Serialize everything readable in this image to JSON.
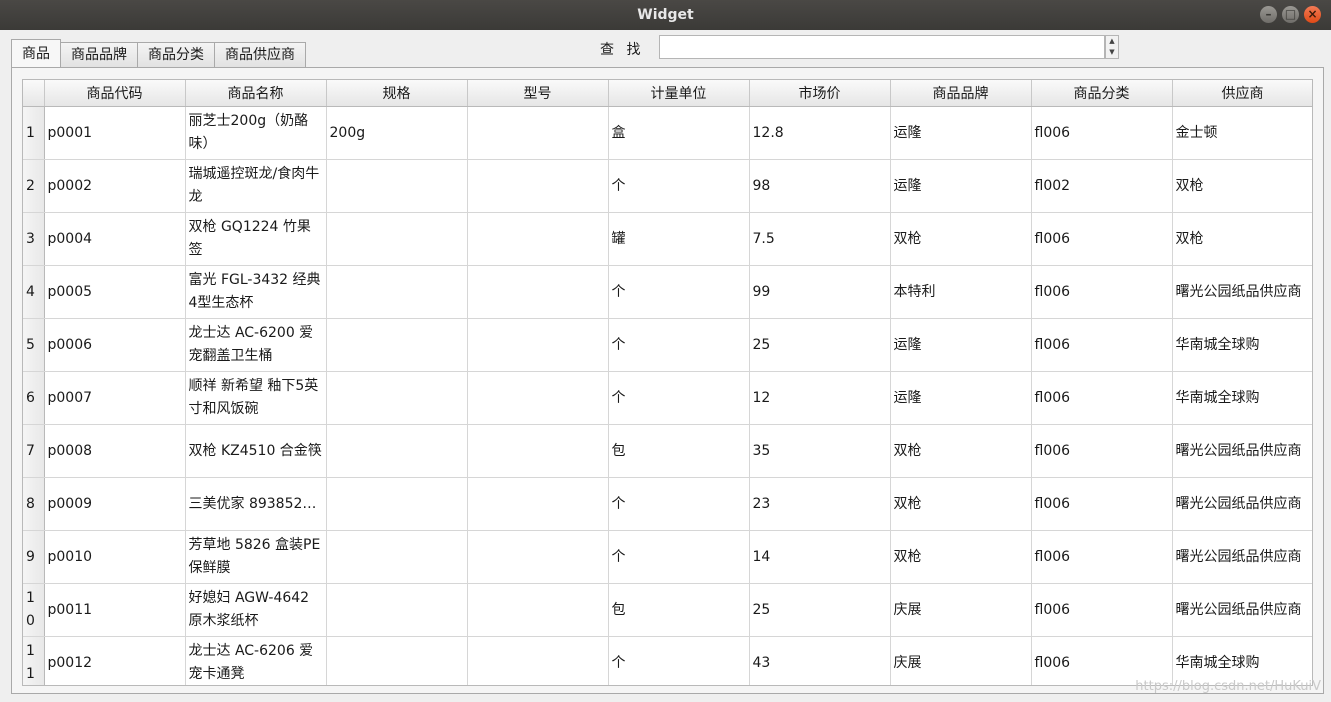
{
  "window": {
    "title": "Widget",
    "minimize": "–",
    "maximize": "□",
    "close": "×"
  },
  "tabs": [
    {
      "label": "商品"
    },
    {
      "label": "商品品牌"
    },
    {
      "label": "商品分类"
    },
    {
      "label": "商品供应商"
    }
  ],
  "search": {
    "label": "查 找",
    "value": ""
  },
  "table": {
    "headers": [
      "商品代码",
      "商品名称",
      "规格",
      "型号",
      "计量单位",
      "市场价",
      "商品品牌",
      "商品分类",
      "供应商"
    ],
    "rows": [
      {
        "n": "1",
        "code": "p0001",
        "name": "丽芝士200g（奶酪味）",
        "spec": "200g",
        "model": "",
        "unit": "盒",
        "price": "12.8",
        "brand": "运隆",
        "cat": "fl006",
        "supplier": "金士顿"
      },
      {
        "n": "2",
        "code": "p0002",
        "name": "瑞城遥控斑龙/食肉牛龙",
        "spec": "",
        "model": "",
        "unit": "个",
        "price": "98",
        "brand": "运隆",
        "cat": "fl002",
        "supplier": "双枪"
      },
      {
        "n": "3",
        "code": "p0004",
        "name": "双枪 GQ1224 竹果签",
        "spec": "",
        "model": "",
        "unit": "罐",
        "price": "7.5",
        "brand": "双枪",
        "cat": "fl006",
        "supplier": "双枪"
      },
      {
        "n": "4",
        "code": "p0005",
        "name": "富光 FGL-3432 经典4型生态杯",
        "spec": "",
        "model": "",
        "unit": "个",
        "price": "99",
        "brand": "本特利",
        "cat": "fl006",
        "supplier": "曙光公园纸品供应商"
      },
      {
        "n": "5",
        "code": "p0006",
        "name": "龙士达 AC-6200 爱宠翻盖卫生桶",
        "spec": "",
        "model": "",
        "unit": "个",
        "price": "25",
        "brand": "运隆",
        "cat": "fl006",
        "supplier": "华南城全球购"
      },
      {
        "n": "6",
        "code": "p0007",
        "name": "顺祥 新希望 釉下5英寸和风饭碗",
        "spec": "",
        "model": "",
        "unit": "个",
        "price": "12",
        "brand": "运隆",
        "cat": "fl006",
        "supplier": "华南城全球购"
      },
      {
        "n": "7",
        "code": "p0008",
        "name": "双枪 KZ4510 合金筷",
        "spec": "",
        "model": "",
        "unit": "包",
        "price": "35",
        "brand": "双枪",
        "cat": "fl006",
        "supplier": "曙光公园纸品供应商"
      },
      {
        "n": "8",
        "code": "p0009",
        "name": "三美优家 893852…",
        "spec": "",
        "model": "",
        "unit": "个",
        "price": "23",
        "brand": "双枪",
        "cat": "fl006",
        "supplier": "曙光公园纸品供应商"
      },
      {
        "n": "9",
        "code": "p0010",
        "name": "芳草地 5826 盒装PE保鲜膜",
        "spec": "",
        "model": "",
        "unit": "个",
        "price": "14",
        "brand": "双枪",
        "cat": "fl006",
        "supplier": "曙光公园纸品供应商"
      },
      {
        "n": "10",
        "code": "p0011",
        "name": "好媳妇 AGW-4642 原木浆纸杯",
        "spec": "",
        "model": "",
        "unit": "包",
        "price": "25",
        "brand": "庆展",
        "cat": "fl006",
        "supplier": "曙光公园纸品供应商"
      },
      {
        "n": "11",
        "code": "p0012",
        "name": "龙士达 AC-6206 爱宠卡通凳",
        "spec": "",
        "model": "",
        "unit": "个",
        "price": "43",
        "brand": "庆展",
        "cat": "fl006",
        "supplier": "华南城全球购"
      }
    ]
  },
  "watermark": "https://blog.csdn.net/HuKuiV"
}
